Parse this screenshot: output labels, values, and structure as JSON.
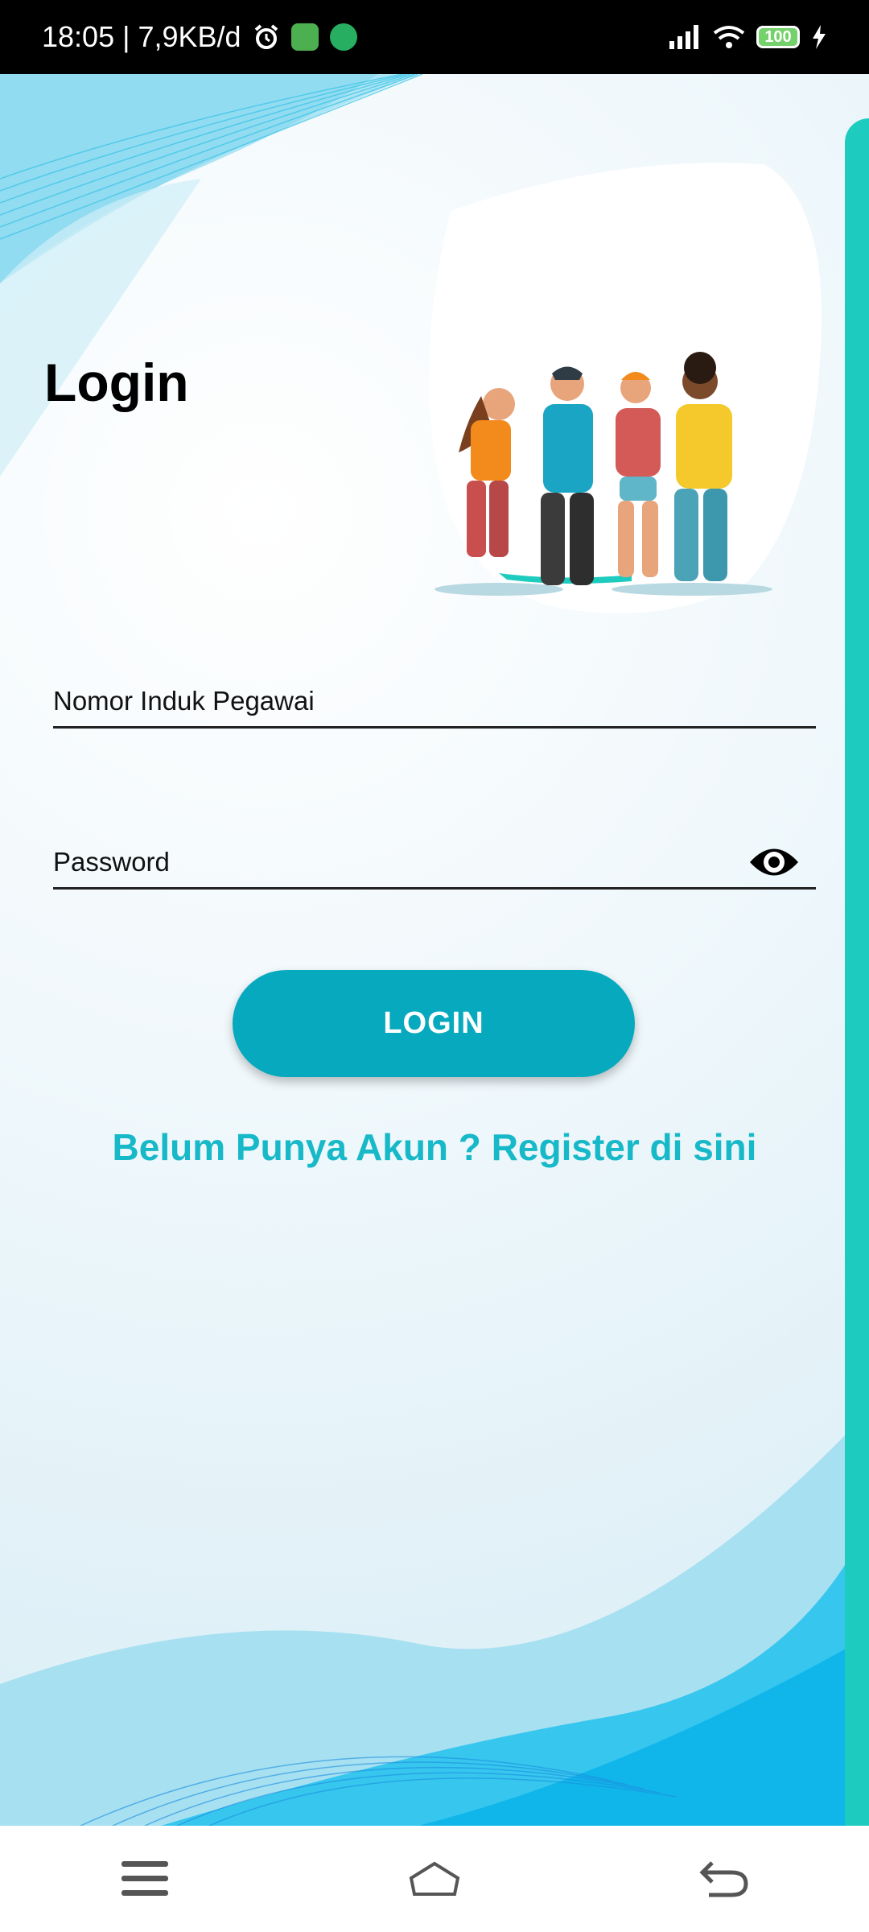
{
  "status_bar": {
    "time_speed": "18:05 | 7,9KB/d",
    "battery_level": "100",
    "icons": [
      "alarm-icon",
      "android-app-icon",
      "green-app-icon",
      "signal-icon",
      "wifi-icon",
      "battery-icon",
      "charging-icon"
    ]
  },
  "login": {
    "title": "Login",
    "npp_placeholder": "Nomor Induk Pegawai",
    "password_placeholder": "Password",
    "button_label": "LOGIN",
    "register_text": "Belum Punya Akun ? Register di sini"
  },
  "colors": {
    "accent": "#06a9be",
    "link": "#17b9c8",
    "edge": "#1ecbbf"
  },
  "nav": {
    "icons": [
      "menu-icon",
      "home-icon",
      "back-icon"
    ]
  }
}
